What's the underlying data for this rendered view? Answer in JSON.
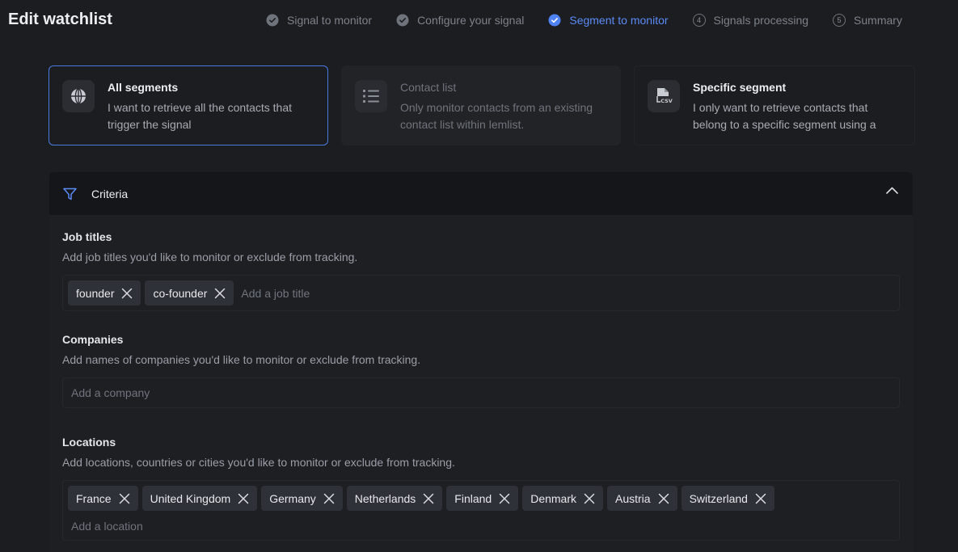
{
  "header": {
    "title": "Edit watchlist",
    "steps": [
      {
        "label": "Signal to monitor",
        "state": "done"
      },
      {
        "label": "Configure your signal",
        "state": "done"
      },
      {
        "label": "Segment to monitor",
        "state": "current"
      },
      {
        "label": "Signals processing",
        "state": "pending",
        "number": "4"
      },
      {
        "label": "Summary",
        "state": "pending",
        "number": "5"
      }
    ]
  },
  "segments": [
    {
      "title": "All segments",
      "desc": "I want to retrieve all the contacts that trigger the signal",
      "icon": "globe-icon",
      "state": "selected"
    },
    {
      "title": "Contact list",
      "desc": "Only monitor contacts from an existing contact list within lemlist.",
      "icon": "list-icon",
      "state": "disabled"
    },
    {
      "title": "Specific segment",
      "desc": "I only want to retrieve contacts that belong to a specific segment using a",
      "icon": "csv-file-icon",
      "state": "default"
    }
  ],
  "criteria": {
    "title": "Criteria",
    "job_titles": {
      "label": "Job titles",
      "desc": "Add job titles you'd like to monitor or exclude from tracking.",
      "tags": [
        "founder",
        "co-founder"
      ],
      "placeholder": "Add a job title"
    },
    "companies": {
      "label": "Companies",
      "desc": "Add names of companies you'd like to monitor or exclude from tracking.",
      "tags": [],
      "placeholder": "Add a company"
    },
    "locations": {
      "label": "Locations",
      "desc": "Add locations, countries or cities you'd like to monitor or exclude from tracking.",
      "tags": [
        "France",
        "United Kingdom",
        "Germany",
        "Netherlands",
        "Finland",
        "Denmark",
        "Austria",
        "Switzerland"
      ],
      "placeholder": "Add a location"
    }
  },
  "colors": {
    "accent": "#5b8bf5",
    "background": "#1c1d21",
    "muted": "#7c818a"
  }
}
